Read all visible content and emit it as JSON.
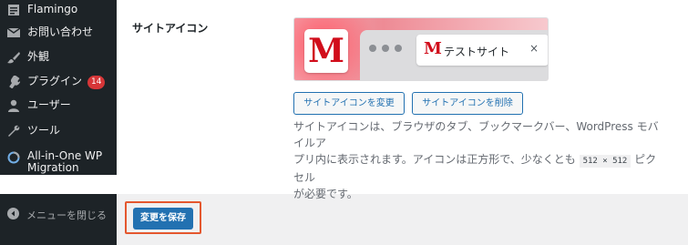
{
  "sidebar": {
    "items": [
      {
        "label": "Flamingo",
        "icon": "flamingo-icon"
      },
      {
        "label": "お問い合わせ",
        "icon": "mail-icon"
      },
      {
        "label": "外観",
        "icon": "paintbrush-icon"
      },
      {
        "label": "プラグイン",
        "icon": "plugin-icon",
        "badge": "14"
      },
      {
        "label": "ユーザー",
        "icon": "user-icon"
      },
      {
        "label": "ツール",
        "icon": "wrench-icon"
      },
      {
        "label": "All-in-One WP",
        "label2": "Migration",
        "icon": "migration-icon"
      }
    ],
    "collapse_label": "メニューを閉じる"
  },
  "settings": {
    "site_icon_label": "サイトアイコン",
    "preview_letter": "M",
    "tab_title": "テストサイト",
    "tab_close": "×",
    "change_button": "サイトアイコンを変更",
    "remove_button": "サイトアイコンを削除",
    "description_1": "サイトアイコンは、ブラウザのタブ、ブックマークバー、WordPress モバイルア",
    "description_2a": "プリ内に表示されます。アイコンは正方形で、少なくとも",
    "description_code": "512 × 512",
    "description_2b": "ピクセル",
    "description_3": "が必要です。"
  },
  "footer": {
    "save_label": "変更を保存"
  },
  "colors": {
    "sidebar_bg": "#1d2327",
    "accent": "#2271b1",
    "badge": "#d63638",
    "logo_red": "#d10d1b",
    "highlight": "#e4572e"
  }
}
